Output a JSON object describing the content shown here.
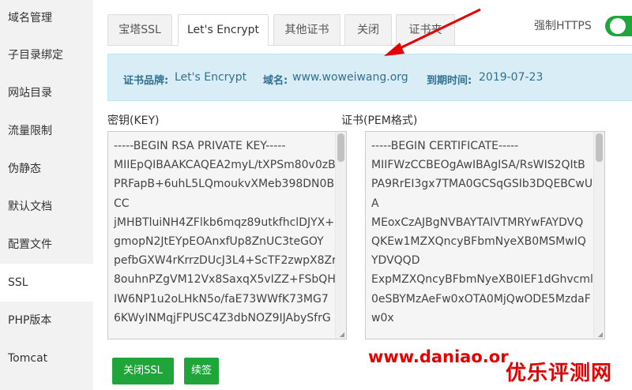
{
  "sidebar": {
    "items": [
      {
        "label": "域名管理"
      },
      {
        "label": "子目录绑定"
      },
      {
        "label": "网站目录"
      },
      {
        "label": "流量限制"
      },
      {
        "label": "伪静态"
      },
      {
        "label": "默认文档"
      },
      {
        "label": "配置文件"
      },
      {
        "label": "SSL"
      },
      {
        "label": "PHP版本"
      },
      {
        "label": "Tomcat"
      }
    ],
    "active": "SSL"
  },
  "tabs": [
    {
      "label": "宝塔SSL"
    },
    {
      "label": "Let's Encrypt"
    },
    {
      "label": "其他证书"
    },
    {
      "label": "关闭"
    },
    {
      "label": "证书夹"
    }
  ],
  "active_tab": "Let's Encrypt",
  "force_https": {
    "label": "强制HTTPS",
    "enabled": true
  },
  "info": {
    "brand_label": "证书品牌:",
    "brand_value": "Let's Encrypt",
    "domain_label": "域名:",
    "domain_value": "www.woweiwang.org",
    "expiry_label": "到期时间:",
    "expiry_value": "2019-07-23"
  },
  "key": {
    "label": "密钥(KEY)",
    "lines": [
      "-----BEGIN RSA PRIVATE KEY-----",
      "MIIEpQIBAAKCAQEA2myL/tXPSm80v0zB",
      "PRFapB+6uhL5LQmoukvXMeb398DN0B",
      "CC",
      "jMHBTluiNH4ZFlkb6mqz89utkfhclDJYX+",
      "gmopN2JtEYpEOAnxfUp8ZnUC3teGOY",
      "pefbGXW4rKrrzDUcJ3L4+ScTF2zwpX8Zr",
      "8ouhnPZgVM12Vx8SaxqX5vIZZ+FSbQH",
      "IW6NP1u2oLHkN5o/faE73WWfK73MG7",
      "6KWyINMqjFPUSC4Z3dbNOZ9IJAbySfrG"
    ]
  },
  "cert": {
    "label": "证书(PEM格式)",
    "lines": [
      "-----BEGIN CERTIFICATE-----",
      "MIIFWzCCBEOgAwIBAgISA/RsWIS2QItB",
      "PA9RrEI3gx7TMA0GCSqGSIb3DQEBCwU",
      "A",
      "MEoxCzAJBgNVBAYTAlVTMRYwFAYDVQ",
      "QKEw1MZXQncyBFbmNyeXB0MSMwIQ",
      "YDVQQD",
      "ExpMZXQncyBFbmNyeXB0IEF1dGhvcml",
      "0eSBYMzAeFw0xOTA0MjQwODE5MzdaF",
      "w0x"
    ]
  },
  "buttons": {
    "close_ssl": "关闭SSL",
    "renew": "续签"
  },
  "watermark": {
    "site": "www.daniao.or",
    "brand": "优乐评测网"
  },
  "colors": {
    "accent": "#20a53a",
    "info_bg": "#d9edf7",
    "info_text": "#31708f",
    "watermark": "#e40000"
  }
}
